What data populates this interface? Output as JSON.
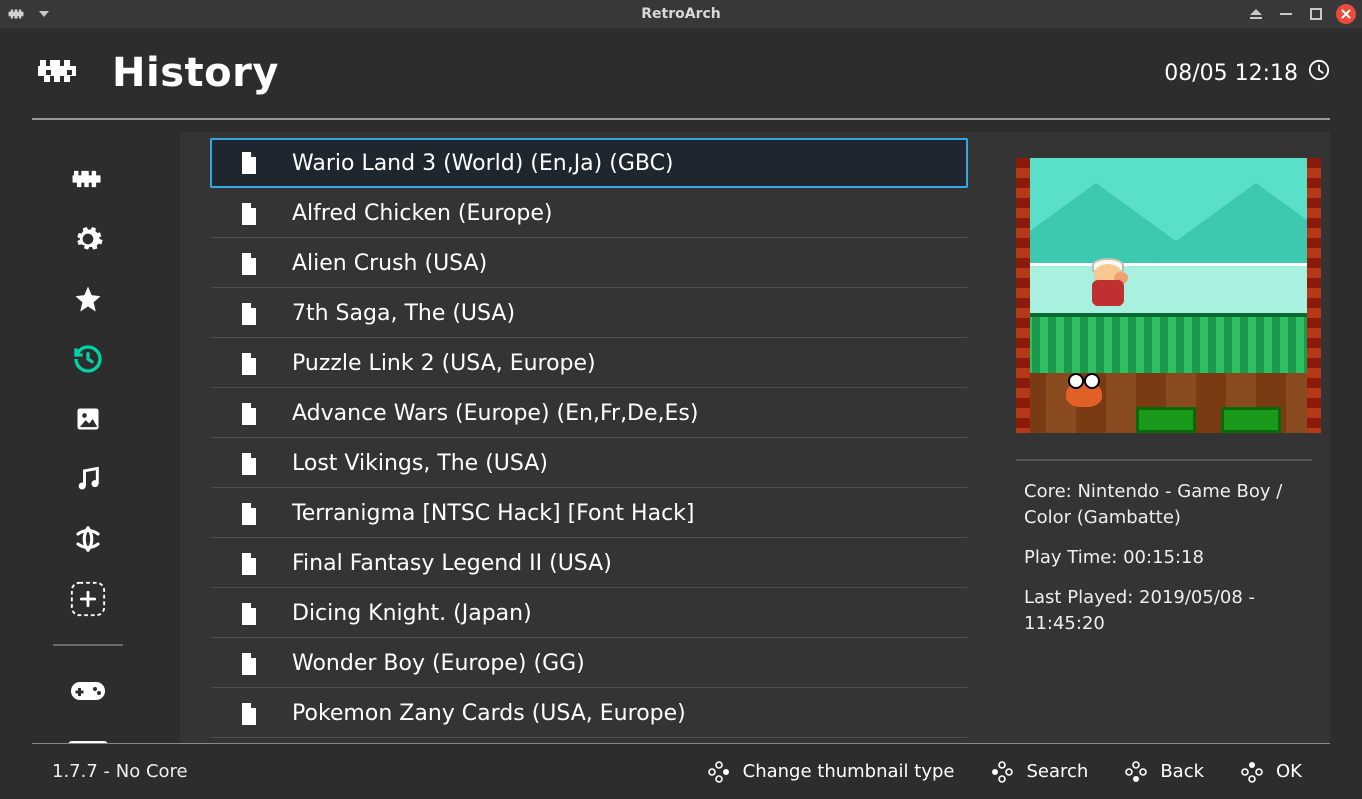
{
  "window": {
    "title": "RetroArch"
  },
  "header": {
    "title": "History",
    "datetime": "08/05 12:18"
  },
  "sidebar": {
    "items": [
      {
        "name": "main-menu",
        "active": false
      },
      {
        "name": "settings",
        "active": false
      },
      {
        "name": "favorites",
        "active": false
      },
      {
        "name": "history",
        "active": true
      },
      {
        "name": "images",
        "active": false
      },
      {
        "name": "music",
        "active": false
      },
      {
        "name": "netplay",
        "active": false
      },
      {
        "name": "add",
        "active": false
      }
    ],
    "playlists": [
      {
        "name": "gamepad-playlist"
      },
      {
        "name": "handheld-playlist"
      }
    ]
  },
  "history": {
    "selectedIndex": 0,
    "items": [
      {
        "label": "Wario Land 3 (World) (En,Ja) (GBC)"
      },
      {
        "label": "Alfred Chicken (Europe)"
      },
      {
        "label": "Alien Crush (USA)"
      },
      {
        "label": "7th Saga, The (USA)"
      },
      {
        "label": "Puzzle Link 2 (USA, Europe)"
      },
      {
        "label": "Advance Wars (Europe) (En,Fr,De,Es)"
      },
      {
        "label": "Lost Vikings, The (USA)"
      },
      {
        "label": "Terranigma [NTSC Hack] [Font Hack]"
      },
      {
        "label": "Final Fantasy Legend II (USA)"
      },
      {
        "label": "Dicing Knight. (Japan)"
      },
      {
        "label": "Wonder Boy (Europe) (GG)"
      },
      {
        "label": "Pokemon Zany Cards (USA, Europe)"
      }
    ]
  },
  "details": {
    "core_label": "Core: ",
    "core_value": "Nintendo - Game Boy / Color (Gambatte)",
    "playtime_label": "Play Time: ",
    "playtime_value": "00:15:18",
    "lastplayed_label": "Last Played: ",
    "lastplayed_value": "2019/05/08 - 11:45:20"
  },
  "footer": {
    "status": "1.7.7 - No Core",
    "actions": {
      "thumbnail": "Change thumbnail type",
      "search": "Search",
      "back": "Back",
      "ok": "OK"
    }
  }
}
